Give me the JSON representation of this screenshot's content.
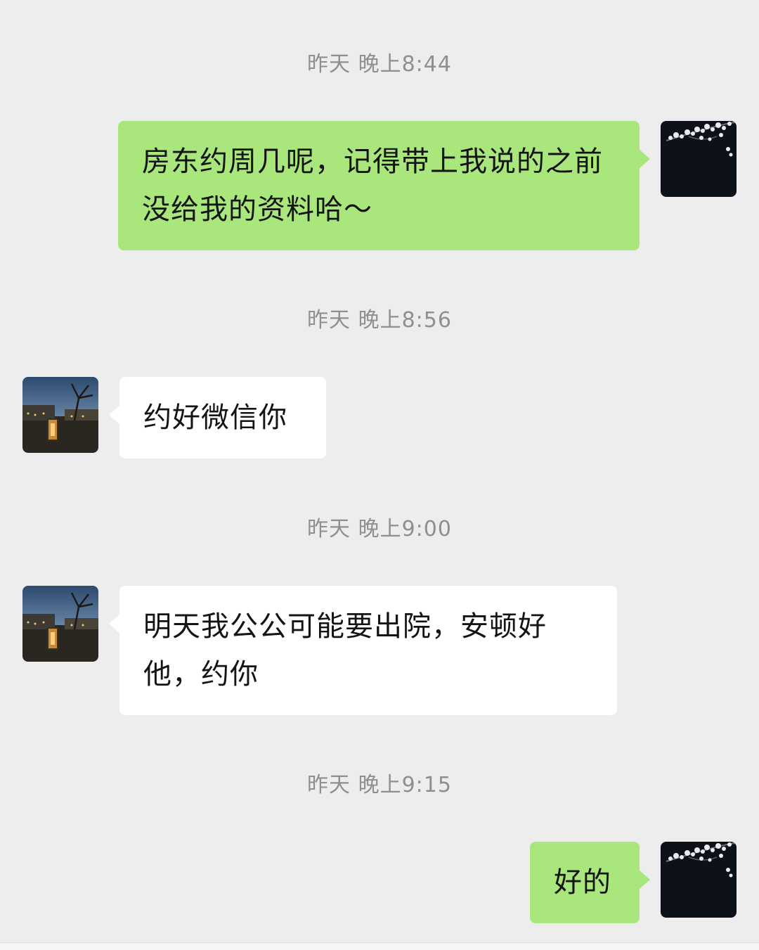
{
  "colors": {
    "background": "#ededed",
    "my_bubble": "#a9e77d",
    "other_bubble": "#ffffff",
    "timestamp_text": "#8f8f8f"
  },
  "messages": [
    {
      "timestamp": "昨天 晚上8:44",
      "sender": "me",
      "avatar_icon": "plum-blossom-avatar-icon",
      "text": "房东约周几呢，记得带上我说的之前没给我的资料哈～"
    },
    {
      "timestamp": "昨天 晚上8:56",
      "sender": "other",
      "avatar_icon": "night-courtyard-avatar-icon",
      "text": "约好微信你"
    },
    {
      "timestamp": "昨天 晚上9:00",
      "sender": "other",
      "avatar_icon": "night-courtyard-avatar-icon",
      "text": "明天我公公可能要出院，安顿好他，约你"
    },
    {
      "timestamp": "昨天 晚上9:15",
      "sender": "me",
      "avatar_icon": "plum-blossom-avatar-icon",
      "text": "好的"
    }
  ]
}
